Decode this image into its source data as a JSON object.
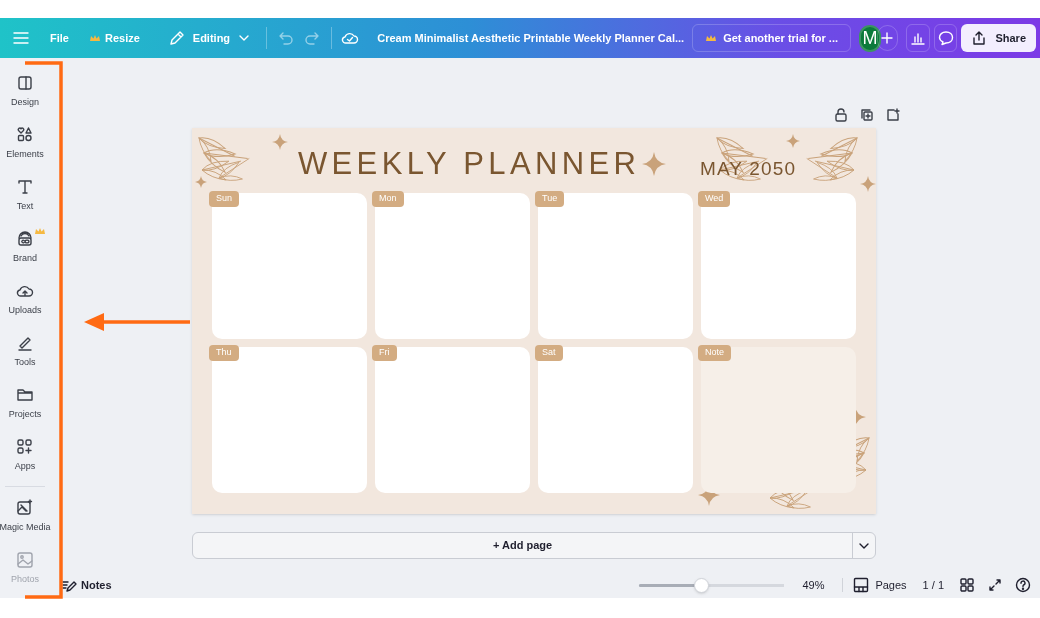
{
  "top_bar": {
    "file": "File",
    "resize": "Resize",
    "mode": "Editing",
    "document_title": "Cream Minimalist Aesthetic Printable Weekly Planner Cal...",
    "trial": "Get another trial for ...",
    "avatar": "M",
    "share": "Share"
  },
  "sidebar": {
    "items": [
      {
        "kind": "design",
        "label": "Design",
        "premium": false,
        "faded": false
      },
      {
        "kind": "elements",
        "label": "Elements",
        "premium": false,
        "faded": false
      },
      {
        "kind": "text",
        "label": "Text",
        "premium": false,
        "faded": false
      },
      {
        "kind": "brand",
        "label": "Brand",
        "premium": true,
        "faded": false
      },
      {
        "kind": "uploads",
        "label": "Uploads",
        "premium": false,
        "faded": false
      },
      {
        "kind": "tools",
        "label": "Tools",
        "premium": false,
        "faded": false
      },
      {
        "kind": "projects",
        "label": "Projects",
        "premium": false,
        "faded": false
      },
      {
        "kind": "apps",
        "label": "Apps",
        "premium": false,
        "faded": false
      }
    ],
    "more_items": [
      {
        "kind": "magic",
        "label": "Magic Media",
        "premium": false,
        "faded": false
      },
      {
        "kind": "photos",
        "label": "Photos",
        "premium": false,
        "faded": true
      }
    ]
  },
  "planner": {
    "title": "WEEKLY PLANNER",
    "month": "MAY 2050",
    "days": [
      {
        "label": "Sun",
        "kind": "day"
      },
      {
        "label": "Mon",
        "kind": "day"
      },
      {
        "label": "Tue",
        "kind": "day"
      },
      {
        "label": "Wed",
        "kind": "day"
      },
      {
        "label": "Thu",
        "kind": "day"
      },
      {
        "label": "Fri",
        "kind": "day"
      },
      {
        "label": "Sat",
        "kind": "day"
      },
      {
        "label": "Note",
        "kind": "note"
      }
    ]
  },
  "add_page": "+ Add page",
  "status_bar": {
    "notes": "Notes",
    "zoom": {
      "level": 0.42,
      "reading": "49%"
    },
    "pages": "Pages",
    "page_count": "1 / 1"
  }
}
